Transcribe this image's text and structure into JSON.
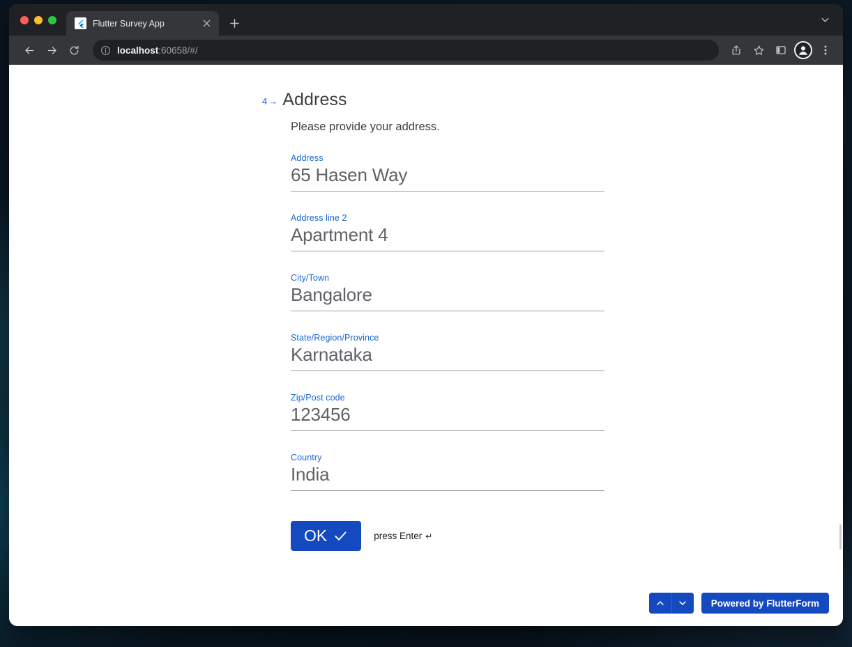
{
  "window": {
    "traffic_lights": [
      "close",
      "minimize",
      "maximize"
    ],
    "tab": {
      "title": "Flutter Survey App",
      "favicon": "flutter-logo-icon",
      "close_icon": "close-icon"
    },
    "new_tab_icon": "plus-icon",
    "tab_list_icon": "chevron-down-icon"
  },
  "toolbar": {
    "back_icon": "arrow-left-icon",
    "forward_icon": "arrow-right-icon",
    "reload_icon": "reload-icon",
    "site_info_icon": "info-circle-icon",
    "url_host": "localhost",
    "url_rest": ":60658/#/",
    "share_icon": "share-icon",
    "bookmark_icon": "star-icon",
    "sidebar_icon": "sidebar-panel-icon",
    "profile_icon": "account-avatar-icon",
    "menu_icon": "three-dot-menu-icon"
  },
  "question": {
    "number": "4",
    "arrow": "→",
    "title": "Address",
    "description": "Please provide your address."
  },
  "fields": [
    {
      "label": "Address",
      "value": "65 Hasen Way",
      "placeholder": ""
    },
    {
      "label": "Address line 2",
      "value": "Apartment 4",
      "placeholder": ""
    },
    {
      "label": "City/Town",
      "value": "Bangalore",
      "placeholder": ""
    },
    {
      "label": "State/Region/Province",
      "value": "Karnataka",
      "placeholder": ""
    },
    {
      "label": "Zip/Post code",
      "value": "123456",
      "placeholder": ""
    },
    {
      "label": "Country",
      "value": "India",
      "placeholder": ""
    }
  ],
  "actions": {
    "ok_label": "OK",
    "ok_icon": "check-icon",
    "hint_text": "press Enter",
    "hint_symbol": "↵"
  },
  "bottom_bar": {
    "prev_icon": "chevron-up-icon",
    "next_icon": "chevron-down-icon",
    "powered_label": "Powered by FlutterForm"
  },
  "colors": {
    "accent_blue": "#1549bf",
    "label_blue": "#1967d2",
    "title_gray": "#3c4043",
    "input_gray": "#5f6368",
    "chrome_dark": "#202124",
    "chrome_toolbar": "#35363a"
  }
}
